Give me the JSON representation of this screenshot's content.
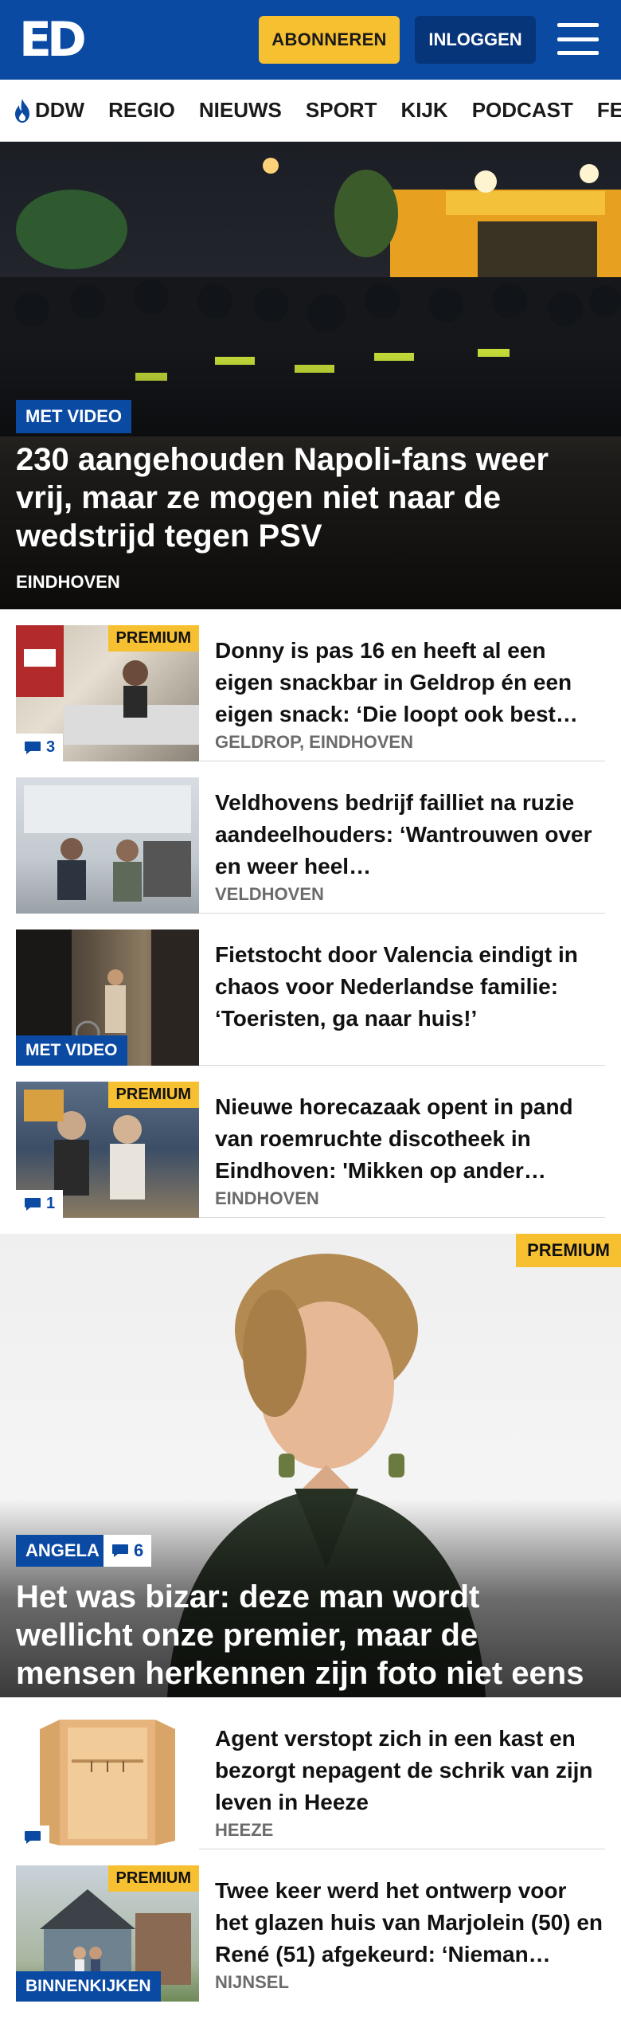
{
  "header": {
    "logo_text": "ED",
    "subscribe_label": "ABONNEREN",
    "login_label": "INLOGGEN"
  },
  "nav": {
    "items": [
      "DDW",
      "REGIO",
      "NIEUWS",
      "SPORT",
      "KIJK",
      "PODCAST",
      "FEB"
    ]
  },
  "hero": {
    "badge": "MET VIDEO",
    "title": "230 aangehouden Napoli-fans weer vrij, maar ze mogen niet naar de wedstrijd tegen PSV",
    "location": "EINDHOVEN"
  },
  "articles": [
    {
      "title": "Donny is pas 16 en heeft al een eigen snackbar in Geldrop én een eigen snack: ‘Die loopt ook best…",
      "location": "GELDROP, EINDHOVEN",
      "premium": "PREMIUM",
      "comments": "3"
    },
    {
      "title": "Veldhovens bedrijf failliet na ruzie aandeelhouders: ‘Wantrouwen over en weer heel…",
      "location": "VELDHOVEN"
    },
    {
      "title": "Fietstocht door Valencia eindigt in chaos voor Nederlandse familie: ‘Toeristen, ga naar huis!’",
      "badge": "MET VIDEO"
    },
    {
      "title": "Nieuwe horecazaak opent in pand van roemruchte discotheek in Eindhoven: 'Mikken op ander…",
      "location": "EINDHOVEN",
      "premium": "PREMIUM",
      "comments": "1"
    }
  ],
  "feature": {
    "premium": "PREMIUM",
    "tag": "ANGELA",
    "comments": "6",
    "title": "Het was bizar: deze man wordt wellicht onze premier, maar de mensen herkennen zijn foto niet eens"
  },
  "articles2": [
    {
      "title": "Agent verstopt zich in een kast en bezorgt nepagent de schrik van zijn leven in Heeze",
      "location": "HEEZE"
    },
    {
      "title": "Twee keer werd het ontwerp voor het glazen huis van Marjolein (50) en René (51) afgekeurd: ‘Nieman…",
      "location": "NIJNSEL",
      "premium": "PREMIUM",
      "badge": "BINNENKIJKEN"
    }
  ],
  "colors": {
    "brand_blue": "#0a4aa3",
    "premium_yellow": "#f6c030"
  }
}
